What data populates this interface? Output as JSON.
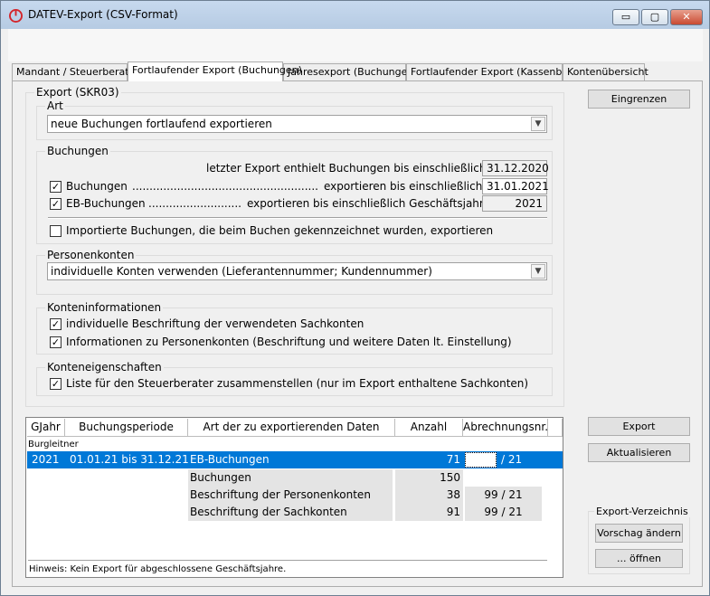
{
  "window": {
    "title": "DATEV-Export (CSV-Format)",
    "minimize": "▭",
    "maximize": "▢",
    "close": "✕"
  },
  "tabs": [
    {
      "label": "Mandant / Steuerberater"
    },
    {
      "label": "Fortlaufender Export (Buchungen)"
    },
    {
      "label": "Jahresexport (Buchungen)"
    },
    {
      "label": "Fortlaufender Export (Kassenbuch)"
    },
    {
      "label": "Kontenübersicht"
    }
  ],
  "export": {
    "title": "Export (SKR03)",
    "art": {
      "label": "Art",
      "value": "neue Buchungen fortlaufend exportieren"
    },
    "buchungen": {
      "label": "Buchungen",
      "last_export_label": "letzter Export enthielt Buchungen bis einschließlich:",
      "last_export_value": "31.12.2020",
      "buchungen_check": "✓",
      "buchungen_label": "Buchungen",
      "buchungen_dots": "........................................................",
      "buchungen_until_label": "exportieren bis einschließlich:",
      "buchungen_until_value": "31.01.2021",
      "eb_check": "✓",
      "eb_label": "EB-Buchungen",
      "eb_dots": "............................",
      "eb_until_label": "exportieren bis einschließlich Geschäftsjahr:",
      "eb_until_value": "2021",
      "importiert_check": "",
      "importiert_label": "Importierte Buchungen, die beim Buchen gekennzeichnet wurden, exportieren"
    },
    "personenkonten": {
      "label": "Personenkonten",
      "value": "individuelle Konten verwenden (Lieferantennummer; Kundennummer)"
    },
    "konteninfo": {
      "label": "Konteninformationen",
      "item1_check": "✓",
      "item1": "individuelle Beschriftung der verwendeten Sachkonten",
      "item2_check": "✓",
      "item2": "Informationen zu Personenkonten (Beschriftung und weitere Daten lt. Einstellung)"
    },
    "konteneigenschaften": {
      "label": "Konteneigenschaften",
      "item1_check": "✓",
      "item1": "Liste für den Steuerberater zusammenstellen (nur im Export enthaltene Sachkonten)"
    }
  },
  "buttons": {
    "eingrenzen": "Eingrenzen",
    "export": "Export",
    "aktualisieren": "Aktualisieren",
    "export_verzeichnis": "Export-Verzeichnis",
    "vorschlag": "Vorschag ändern",
    "oeffnen": "... öffnen"
  },
  "grid": {
    "columns": [
      "GJahr",
      "Buchungsperiode",
      "Art der zu exportierenden Daten",
      "Anzahl",
      "Abrechnungsnr."
    ],
    "group": "Burgleitner",
    "rows": [
      {
        "gjahr": "2021",
        "periode": "01.01.21 bis 31.12.21",
        "art": "EB-Buchungen",
        "anzahl": "71",
        "abr": "/ 21"
      },
      {
        "gjahr": "",
        "periode": "",
        "art": "Buchungen",
        "anzahl": "150",
        "abr": ""
      },
      {
        "gjahr": "",
        "periode": "",
        "art": "Beschriftung der Personenkonten",
        "anzahl": "38",
        "abr": "99 / 21"
      },
      {
        "gjahr": "",
        "periode": "",
        "art": "Beschriftung der Sachkonten",
        "anzahl": "91",
        "abr": "99 / 21"
      }
    ],
    "hint": "Hinweis: Kein Export für abgeschlossene Geschäftsjahre."
  },
  "colors": {
    "selection": "#0078d7",
    "title_bar": "#bfd3ea",
    "close_button": "#c94a32"
  }
}
